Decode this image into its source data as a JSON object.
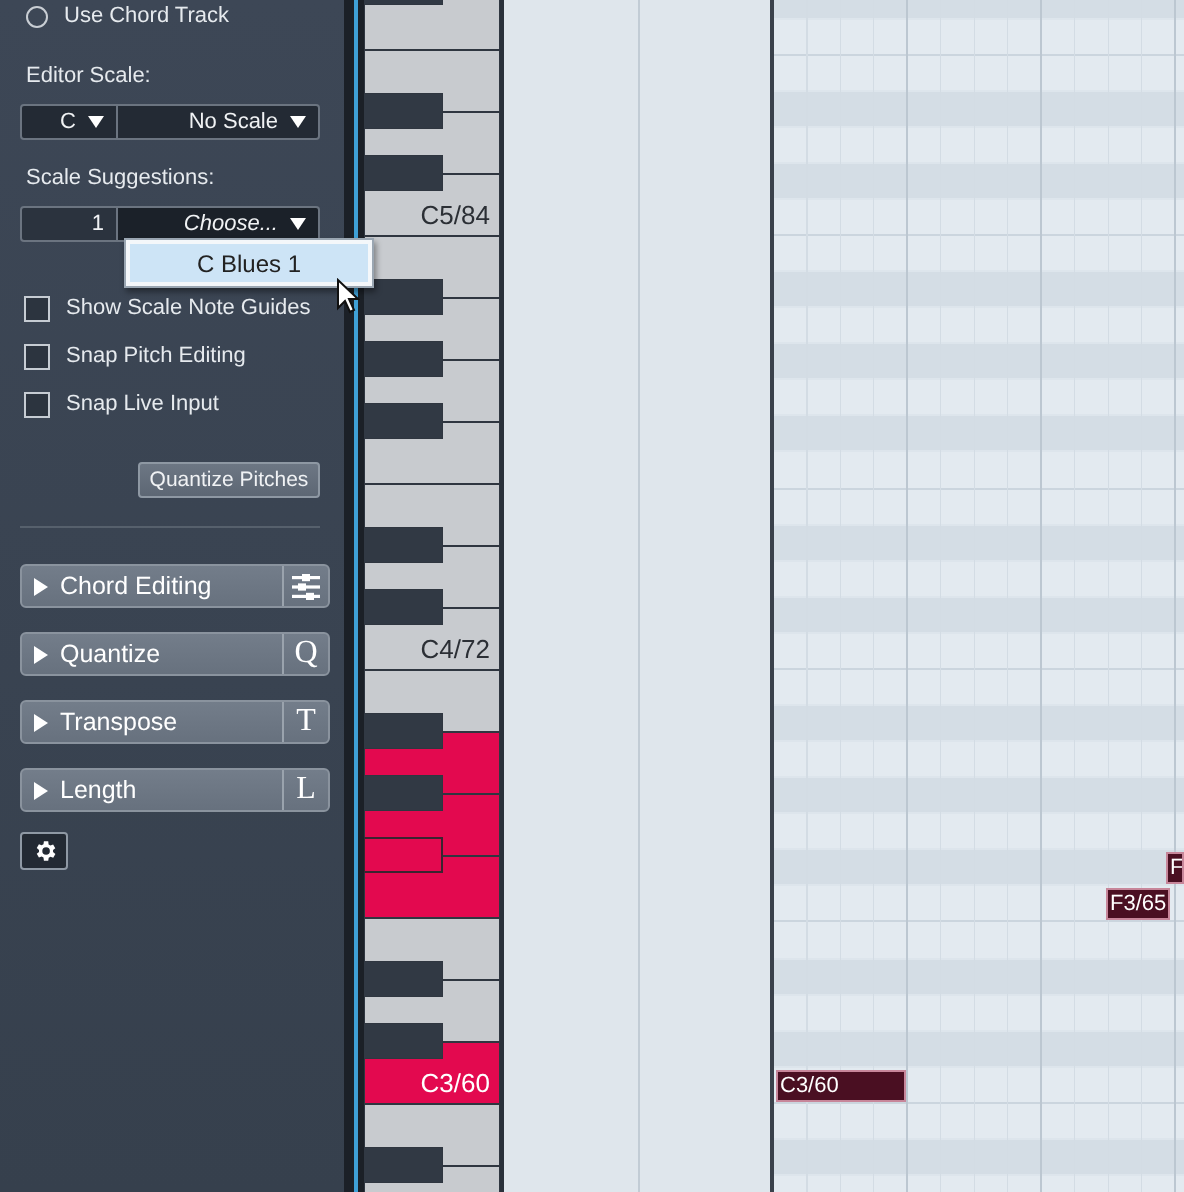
{
  "inspector": {
    "chord_track": {
      "label": "Use Chord Track",
      "selected": false
    },
    "editor_scale": {
      "label": "Editor Scale:",
      "root": "C",
      "scale": "No Scale"
    },
    "scale_suggestions": {
      "label": "Scale Suggestions:",
      "count": "1",
      "choice": "Choose..."
    },
    "suggestion_menu": {
      "items": [
        {
          "label": "C Blues 1",
          "selected": true
        }
      ]
    },
    "options": [
      {
        "label": "Show Scale Note Guides",
        "checked": false
      },
      {
        "label": "Snap Pitch Editing",
        "checked": false
      },
      {
        "label": "Snap Live Input",
        "checked": false
      }
    ],
    "quantize_button": "Quantize Pitches",
    "sections": [
      {
        "label": "Chord Editing",
        "expanded": false,
        "kind": "sliders"
      },
      {
        "label": "Quantize",
        "expanded": false,
        "kind": "letter",
        "key": "Q"
      },
      {
        "label": "Transpose",
        "expanded": false,
        "kind": "letter",
        "key": "T"
      },
      {
        "label": "Length",
        "expanded": false,
        "kind": "letter",
        "key": "L"
      }
    ]
  },
  "keyboard": {
    "octaves": [
      {
        "label": "C5/84",
        "keys": [
          {
            "highlighted": false
          },
          {
            "highlighted": false
          },
          {
            "highlighted": false
          },
          {
            "highlighted": false
          },
          {
            "highlighted": false
          },
          {
            "highlighted": false
          },
          {
            "highlighted": false
          }
        ]
      },
      {
        "label": "C4/72",
        "keys": [
          {
            "highlighted": false
          },
          {
            "highlighted": false
          },
          {
            "highlighted": false
          },
          {
            "highlighted": false
          },
          {
            "highlighted": false
          },
          {
            "highlighted": false
          },
          {
            "highlighted": false
          },
          {
            "highlighted": false
          },
          {
            "highlighted": false
          },
          {
            "highlighted": false
          },
          {
            "highlighted": false
          },
          {
            "highlighted": false
          }
        ]
      },
      {
        "label": "C3/60",
        "keys": [
          {
            "highlighted": false
          },
          {
            "highlighted": false
          },
          {
            "highlighted": true
          },
          {
            "highlighted": false
          },
          {
            "highlighted": true
          },
          {
            "highlighted": true,
            "notes": [
              {
                "label": "F"
              }
            ]
          },
          {
            "highlighted": true,
            "notes": [
              {
                "label": "F3/65"
              }
            ]
          },
          {
            "highlighted": false
          },
          {
            "highlighted": false
          },
          {
            "highlighted": false
          },
          {
            "highlighted": false
          },
          {
            "highlighted": true,
            "notes": [
              {
                "label": "C3/60"
              }
            ]
          }
        ]
      },
      {
        "keys": [
          {
            "highlighted": false
          },
          {
            "highlighted": false
          },
          {
            "highlighted": false
          }
        ]
      }
    ]
  }
}
